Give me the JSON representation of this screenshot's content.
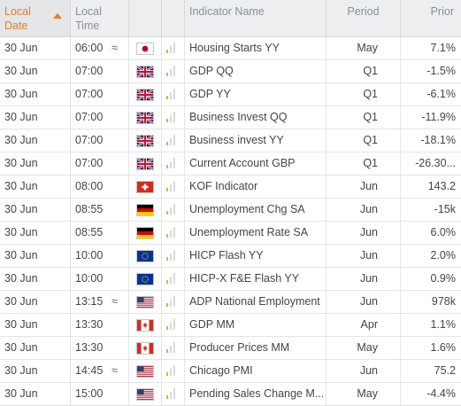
{
  "columns": {
    "date": "Local Date",
    "time": "Local Time",
    "indicator": "Indicator Name",
    "period": "Period",
    "prior": "Prior"
  },
  "sort": {
    "column": "date",
    "direction": "ascending"
  },
  "colors": {
    "accent": "#f07a1a",
    "importance_on": "#f4a63a",
    "importance_off": "#d8dadc",
    "header_bg": "#eceef0"
  },
  "rows": [
    {
      "date": "30 Jun",
      "time": "06:00",
      "approx": "≈",
      "flag": "jp-flag-icon",
      "importance": 1,
      "name": "Housing Starts YY",
      "period": "May",
      "prior": "7.1%"
    },
    {
      "date": "30 Jun",
      "time": "07:00",
      "approx": "",
      "flag": "gb-flag-icon",
      "importance": 1,
      "name": "GDP QQ",
      "period": "Q1",
      "prior": "-1.5%"
    },
    {
      "date": "30 Jun",
      "time": "07:00",
      "approx": "",
      "flag": "gb-flag-icon",
      "importance": 1,
      "name": "GDP YY",
      "period": "Q1",
      "prior": "-6.1%"
    },
    {
      "date": "30 Jun",
      "time": "07:00",
      "approx": "",
      "flag": "gb-flag-icon",
      "importance": 1,
      "name": "Business Invest QQ",
      "period": "Q1",
      "prior": "-11.9%"
    },
    {
      "date": "30 Jun",
      "time": "07:00",
      "approx": "",
      "flag": "gb-flag-icon",
      "importance": 1,
      "name": "Business invest YY",
      "period": "Q1",
      "prior": "-18.1%"
    },
    {
      "date": "30 Jun",
      "time": "07:00",
      "approx": "",
      "flag": "gb-flag-icon",
      "importance": 1,
      "name": "Current Account GBP",
      "period": "Q1",
      "prior": "-26.30..."
    },
    {
      "date": "30 Jun",
      "time": "08:00",
      "approx": "",
      "flag": "ch-flag-icon",
      "importance": 1,
      "name": "KOF Indicator",
      "period": "Jun",
      "prior": "143.2"
    },
    {
      "date": "30 Jun",
      "time": "08:55",
      "approx": "",
      "flag": "de-flag-icon",
      "importance": 1,
      "name": "Unemployment Chg SA",
      "period": "Jun",
      "prior": "-15k"
    },
    {
      "date": "30 Jun",
      "time": "08:55",
      "approx": "",
      "flag": "de-flag-icon",
      "importance": 1,
      "name": "Unemployment Rate SA",
      "period": "Jun",
      "prior": "6.0%"
    },
    {
      "date": "30 Jun",
      "time": "10:00",
      "approx": "",
      "flag": "eu-flag-icon",
      "importance": 1,
      "name": "HICP Flash YY",
      "period": "Jun",
      "prior": "2.0%"
    },
    {
      "date": "30 Jun",
      "time": "10:00",
      "approx": "",
      "flag": "eu-flag-icon",
      "importance": 1,
      "name": "HICP-X F&E Flash YY",
      "period": "Jun",
      "prior": "0.9%"
    },
    {
      "date": "30 Jun",
      "time": "13:15",
      "approx": "≈",
      "flag": "us-flag-icon",
      "importance": 1,
      "name": "ADP National Employment",
      "period": "Jun",
      "prior": "978k"
    },
    {
      "date": "30 Jun",
      "time": "13:30",
      "approx": "",
      "flag": "ca-flag-icon",
      "importance": 1,
      "name": "GDP MM",
      "period": "Apr",
      "prior": "1.1%"
    },
    {
      "date": "30 Jun",
      "time": "13:30",
      "approx": "",
      "flag": "ca-flag-icon",
      "importance": 1,
      "name": "Producer Prices MM",
      "period": "May",
      "prior": "1.6%"
    },
    {
      "date": "30 Jun",
      "time": "14:45",
      "approx": "≈",
      "flag": "us-flag-icon",
      "importance": 1,
      "name": "Chicago PMI",
      "period": "Jun",
      "prior": "75.2"
    },
    {
      "date": "30 Jun",
      "time": "15:00",
      "approx": "",
      "flag": "us-flag-icon",
      "importance": 1,
      "name": "Pending Sales Change M...",
      "period": "May",
      "prior": "-4.4%"
    }
  ]
}
